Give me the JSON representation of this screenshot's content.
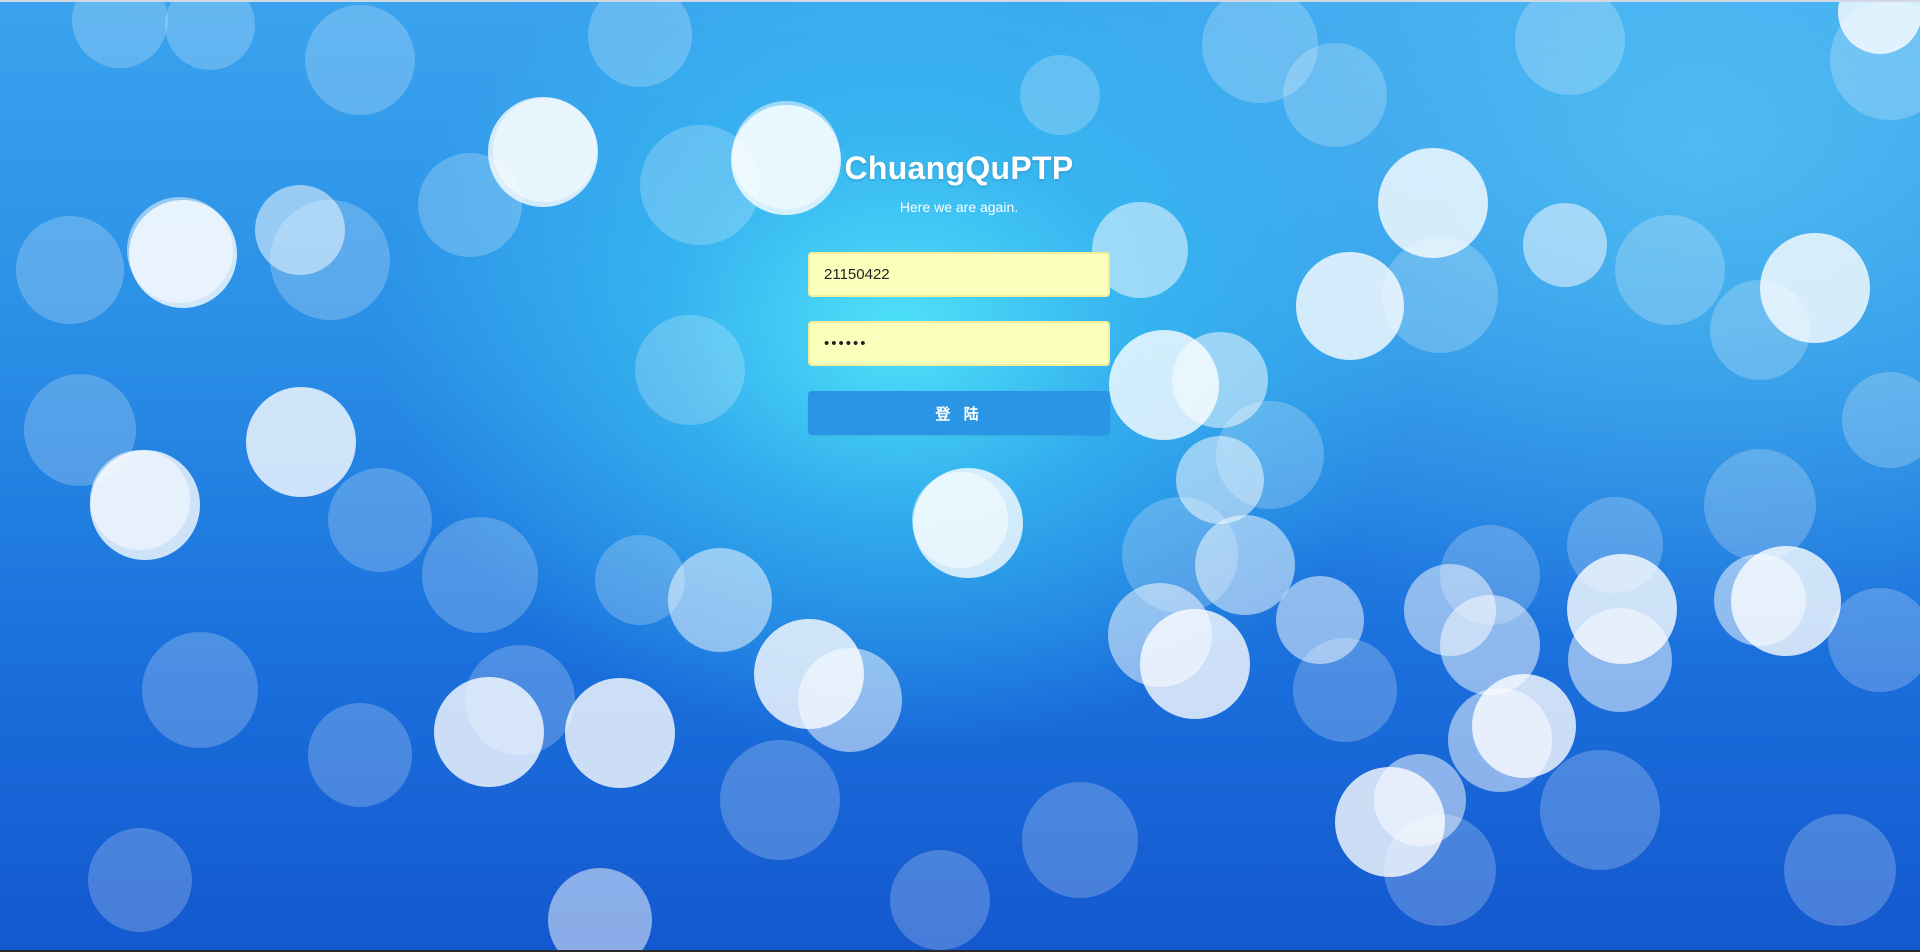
{
  "login": {
    "title": "ChuangQuPTP",
    "subtitle": "Here we are again.",
    "username_value": "21150422",
    "password_value": "••••••",
    "submit_label": "登 陆"
  },
  "background": {
    "theme": "blue bokeh",
    "colors": [
      "#3aa3ee",
      "#1458cf",
      "#50e6fa"
    ]
  }
}
